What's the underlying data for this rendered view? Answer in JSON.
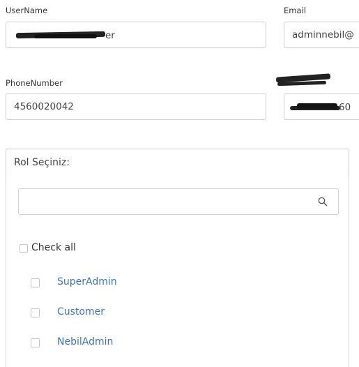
{
  "form": {
    "username": {
      "label": "UserName",
      "value_suffix": "er"
    },
    "email": {
      "label": "Email",
      "value": "adminnebil@"
    },
    "phone": {
      "label": "PhoneNumber",
      "value": "4560020042"
    },
    "extra": {
      "value_suffix": "60"
    }
  },
  "role_select": {
    "placeholder": "Rol Seçiniz:",
    "search_value": "",
    "check_all_label": "Check all",
    "options": [
      {
        "label": "SuperAdmin",
        "checked": false
      },
      {
        "label": "Customer",
        "checked": false
      },
      {
        "label": "NebilAdmin",
        "checked": false
      }
    ]
  }
}
